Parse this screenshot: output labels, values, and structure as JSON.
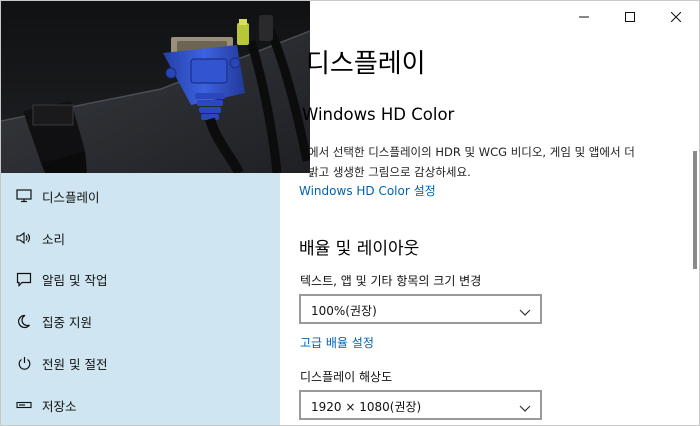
{
  "window": {
    "controls": [
      "minimize",
      "maximize",
      "close"
    ]
  },
  "sidebar": {
    "items": [
      {
        "label": "디스플레이",
        "icon": "monitor-icon"
      },
      {
        "label": "소리",
        "icon": "speaker-icon"
      },
      {
        "label": "알림 및 작업",
        "icon": "notification-icon"
      },
      {
        "label": "집중 지원",
        "icon": "moon-icon"
      },
      {
        "label": "전원 및 절전",
        "icon": "power-icon"
      },
      {
        "label": "저장소",
        "icon": "storage-icon"
      }
    ]
  },
  "main": {
    "heading": "디스플레이",
    "hd_color": {
      "title": "Windows HD Color",
      "description_line1": "에서 선택한 디스플레이의 HDR 및 WCG 비디오, 게임 및 앱에서 더",
      "description_line2": "밝고 생생한 그림으로 감상하세요.",
      "link": "Windows HD Color 설정"
    },
    "scale_layout": {
      "title": "배율 및 레이아웃",
      "scale_label": "텍스트, 앱 및 기타 항목의 크기 변경",
      "scale_value": "100%(권장)",
      "advanced_link": "고급 배율 설정",
      "resolution_label": "디스플레이 해상도",
      "resolution_value": "1920 × 1080(권장)"
    }
  },
  "colors": {
    "sidebar_bg": "#cfe5f1",
    "link": "#0063b1",
    "connector_blue": "#2f52c9"
  }
}
